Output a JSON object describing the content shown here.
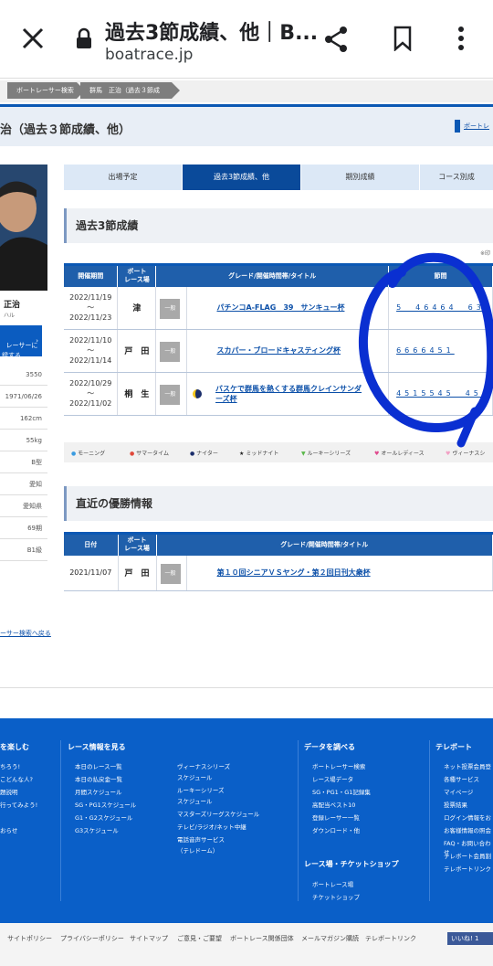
{
  "browser": {
    "title": "過去3節成績、他｜B...",
    "url": "boatrace.jp"
  },
  "breadcrumbs": [
    "ボートレーサー検索",
    "群馬　正治（過去３節成績、他）"
  ],
  "page_heading": "治（過去３節成績、他）",
  "back_link": "ボートレ",
  "racer": {
    "name": "正治",
    "kana": "ハル",
    "profile_button": "レーサーに\n録する"
  },
  "profile": [
    "3550",
    "1971/06/26",
    "162cm",
    "55kg",
    "B型",
    "愛知",
    "愛知県",
    "69期",
    "B1級"
  ],
  "tabs": [
    "出場予定",
    "過去3節成績、他",
    "期別成績",
    "コース別成"
  ],
  "past3": {
    "heading": "過去3節成績",
    "note": "※印",
    "columns": [
      "開催期間",
      "ボート\nレース場",
      "グレード/開催時間帯/タイトル",
      "節間"
    ],
    "rows": [
      {
        "period": [
          "2022/11/19",
          "〜",
          "2022/11/23"
        ],
        "place": "津",
        "grade": "一般",
        "title": "パチンコA-FLAG　39　サンキュー杯",
        "results": "5　46464　63"
      },
      {
        "period": [
          "2022/11/10",
          "〜",
          "2022/11/14"
        ],
        "place": "戸　田",
        "grade": "一般",
        "title": "スカパー・ブロードキャスティング杯",
        "results": "6666451"
      },
      {
        "period": [
          "2022/10/29",
          "〜",
          "2022/11/02"
        ],
        "place": "桐　生",
        "grade": "一般",
        "title": "バスケで群馬を熱くする群馬クレインサンダーズ杯",
        "results": "4515545　45"
      }
    ]
  },
  "legend": [
    "モーニング",
    "サマータイム",
    "ナイター",
    "ミッドナイト",
    "ルーキーシリーズ",
    "オールレディース",
    "ヴィーナスシ"
  ],
  "wins": {
    "heading": "直近の優勝情報",
    "columns": [
      "日付",
      "ボート\nレース場",
      "グレード/開催時間帯/タイトル"
    ],
    "rows": [
      {
        "date": "2021/11/07",
        "place": "戸　田",
        "grade": "一般",
        "title": "第１０回シニアＶＳヤング・第２回日刊大衆杯"
      }
    ]
  },
  "back_to_search": "ーサー検索へ戻る",
  "footer": {
    "col1": {
      "title": "を楽しむ",
      "items": [
        "ちろう!",
        "こどんな人?",
        "題説明",
        "行ってみよう!",
        "",
        "おらせ"
      ]
    },
    "col2": {
      "title": "レース情報を見る",
      "items": [
        "本日のレース一覧",
        "本日の払戻金一覧",
        "月間スケジュール",
        "SG・PG1スケジュール",
        "G1・G2スケジュール",
        "G3スケジュール"
      ]
    },
    "col3": {
      "items": [
        "ヴィーナスシリーズ",
        "スケジュール",
        "ルーキーシリーズ",
        "スケジュール",
        "マスターズリーグスケジュール",
        "テレビ/ラジオ/ネット中継",
        "電話音声サービス",
        "（テレドーム）"
      ]
    },
    "col4": {
      "title": "データを調べる",
      "items": [
        "ボートレーサー検索",
        "レース場データ",
        "SG・PG1・G1記録集",
        "高配当ベスト10",
        "登録レーサー一覧",
        "ダウンロード・他"
      ]
    },
    "col4b": {
      "title": "レース場・チケットショップ",
      "items": [
        "ボートレース場",
        "チケットショップ"
      ]
    },
    "col5": {
      "title": "テレボート",
      "items": [
        "ネット投票会員登",
        "各種サービス",
        "マイページ",
        "投票結果",
        "ログイン情報をお",
        "お客様情報の照会",
        "FAQ・お問い合わせ",
        "テレボート会員割",
        "テレボートリンク"
      ]
    }
  },
  "bottom_links": [
    "サイトポリシー",
    "プライバシーポリシー",
    "サイトマップ",
    "ご意見・ご要望",
    "ボートレース関係団体",
    "メールマガジン購読",
    "テレボートリンク"
  ],
  "like_button": "いいね! 1"
}
